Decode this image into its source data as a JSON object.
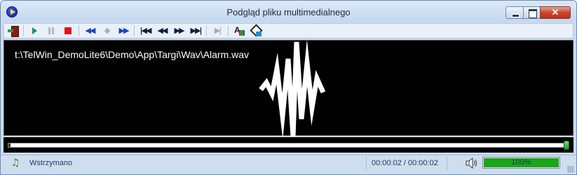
{
  "window": {
    "title": "Podgląd pliku multimedialnego",
    "close_glyph": "✕"
  },
  "toolbar": {
    "buttons": [
      {
        "name": "exit-icon"
      },
      {
        "name": "play-icon"
      },
      {
        "name": "pause-icon"
      },
      {
        "name": "stop-icon"
      },
      {
        "name": "slow-rewind-icon",
        "glyph": "◀◀"
      },
      {
        "name": "slow-normal-icon",
        "glyph": "◆"
      },
      {
        "name": "slow-forward-icon",
        "glyph": "▶▶"
      },
      {
        "name": "skip-to-start-icon",
        "glyph": "|◀◀"
      },
      {
        "name": "rewind-icon",
        "glyph": "◀◀"
      },
      {
        "name": "fast-forward-icon",
        "glyph": "▶▶"
      },
      {
        "name": "skip-to-end-icon",
        "glyph": "▶▶|"
      },
      {
        "name": "step-forward-icon",
        "glyph": "▶|"
      },
      {
        "name": "font-icon"
      },
      {
        "name": "paint-icon"
      }
    ]
  },
  "display": {
    "file_path": "t:\\TelWin_DemoLite6\\Demo\\App\\Targi\\Wav\\Alarm.wav",
    "icon": "waveform-icon"
  },
  "progress": {
    "position_fraction": 1.0
  },
  "status": {
    "state_text": "Wstrzymano",
    "time_text": "00:00:02 / 00:00:02",
    "volume_text": "100%",
    "volume_fraction": 1.0,
    "music_icon": "music-note-icon",
    "speaker_icon": "speaker-icon"
  },
  "colors": {
    "play": "#15905f",
    "stop": "#e0151a",
    "volume": "#1aa51a",
    "display_bg": "#000000"
  }
}
